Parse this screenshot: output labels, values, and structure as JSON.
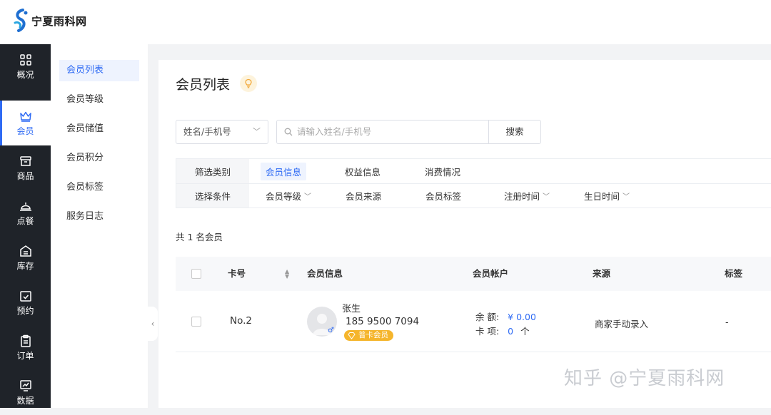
{
  "brand": {
    "name": "宁夏雨科网"
  },
  "sidebar": {
    "items": [
      {
        "label": "概况",
        "icon": "grid-icon"
      },
      {
        "label": "会员",
        "icon": "crown-icon"
      },
      {
        "label": "商品",
        "icon": "box-icon"
      },
      {
        "label": "点餐",
        "icon": "food-cover-icon"
      },
      {
        "label": "库存",
        "icon": "stock-icon"
      },
      {
        "label": "预约",
        "icon": "calendar-check-icon"
      },
      {
        "label": "订单",
        "icon": "clipboard-icon"
      },
      {
        "label": "数据",
        "icon": "chart-monitor-icon"
      }
    ],
    "active": "会员"
  },
  "subnav": {
    "items": [
      "会员列表",
      "会员等级",
      "会员储值",
      "会员积分",
      "会员标签",
      "服务日志"
    ],
    "active": "会员列表"
  },
  "page": {
    "title": "会员列表"
  },
  "search": {
    "field_select": "姓名/手机号",
    "placeholder": "请输入姓名/手机号",
    "button": "搜索"
  },
  "filters": {
    "row1_label": "筛选类别",
    "categories": [
      "会员信息",
      "权益信息",
      "消费情况"
    ],
    "active_category": "会员信息",
    "row2_label": "选择条件",
    "conditions": [
      "会员等级",
      "会员来源",
      "会员标签",
      "注册时间",
      "生日时间"
    ]
  },
  "summary": {
    "count_text": "共 1 名会员"
  },
  "table": {
    "headers": [
      "卡号",
      "会员信息",
      "会员帐户",
      "来源",
      "标签"
    ],
    "rows": [
      {
        "card_no": "No.2",
        "name": "张生",
        "phone": "185 9500 7094",
        "level_badge": "普卡会员",
        "balance_label": "余 额:",
        "balance_value": "¥ 0.00",
        "cards_label": "卡 项:",
        "cards_value": "0",
        "cards_unit": "个",
        "source": "商家手动录入",
        "tag": "-"
      }
    ]
  },
  "watermark": "知乎 @宁夏雨科网",
  "colors": {
    "accent": "#2f6bf4",
    "sidebar_bg": "#1f2329",
    "badge": "#f5b52c"
  }
}
